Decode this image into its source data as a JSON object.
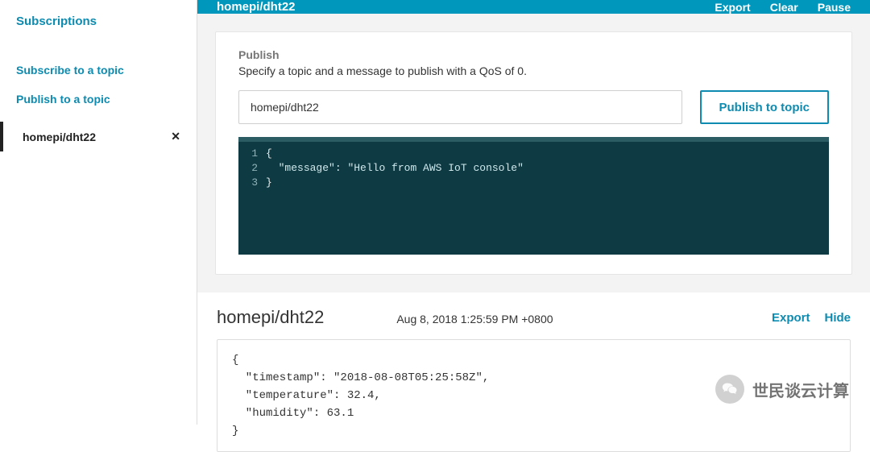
{
  "sidebar": {
    "title": "Subscriptions",
    "subscribe_label": "Subscribe to a topic",
    "publish_label": "Publish to a topic",
    "items": [
      {
        "label": "homepi/dht22"
      }
    ]
  },
  "topbar": {
    "title": "homepi/dht22",
    "export": "Export",
    "clear": "Clear",
    "pause": "Pause"
  },
  "publish": {
    "heading": "Publish",
    "sub": "Specify a topic and a message to publish with a QoS of 0.",
    "topic_value": "homepi/dht22",
    "button": "Publish to topic",
    "editor": {
      "lines": [
        "1",
        "2",
        "3"
      ],
      "code_l1": "{",
      "code_l2_key": "\"message\"",
      "code_l2_sep": ": ",
      "code_l2_val": "\"Hello from AWS IoT console\"",
      "code_l3": "}"
    }
  },
  "message": {
    "topic": "homepi/dht22",
    "timestamp": "Aug 8, 2018 1:25:59 PM +0800",
    "export": "Export",
    "hide": "Hide",
    "payload": "{\n  \"timestamp\": \"2018-08-08T05:25:58Z\",\n  \"temperature\": 32.4,\n  \"humidity\": 63.1\n}"
  },
  "watermark": {
    "text": "世民谈云计算"
  }
}
